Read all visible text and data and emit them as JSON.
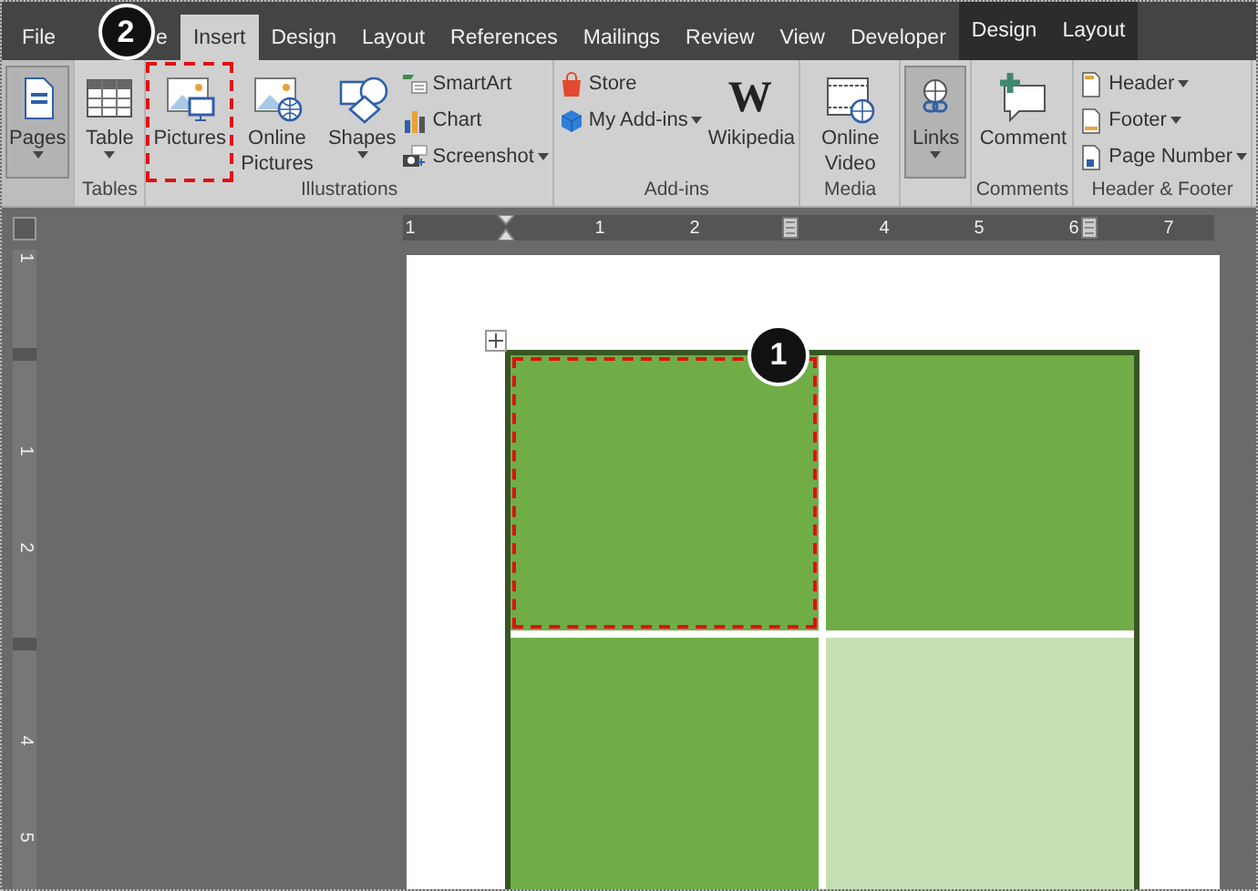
{
  "tabs": [
    {
      "label": "File",
      "selected": false,
      "contextual": false
    },
    {
      "label": "e",
      "selected": false,
      "contextual": false
    },
    {
      "label": "Insert",
      "selected": true,
      "contextual": false
    },
    {
      "label": "Design",
      "selected": false,
      "contextual": false
    },
    {
      "label": "Layout",
      "selected": false,
      "contextual": false
    },
    {
      "label": "References",
      "selected": false,
      "contextual": false
    },
    {
      "label": "Mailings",
      "selected": false,
      "contextual": false
    },
    {
      "label": "Review",
      "selected": false,
      "contextual": false
    },
    {
      "label": "View",
      "selected": false,
      "contextual": false
    },
    {
      "label": "Developer",
      "selected": false,
      "contextual": false
    },
    {
      "label": "Design",
      "selected": false,
      "contextual": true
    },
    {
      "label": "Layout",
      "selected": false,
      "contextual": true
    }
  ],
  "ribbon": {
    "groups": [
      {
        "items": [
          {
            "kind": "large",
            "label": "Pages",
            "dropdown": true,
            "pressed": true,
            "highlighted": false
          }
        ]
      },
      {
        "label": "Tables",
        "items": [
          {
            "kind": "large",
            "label": "Table",
            "dropdown": true,
            "pressed": false,
            "highlighted": false
          }
        ]
      },
      {
        "label": "Illustrations",
        "items": [
          {
            "kind": "large",
            "label": "Pictures",
            "dropdown": false,
            "pressed": false,
            "highlighted": true
          },
          {
            "kind": "large",
            "label": "Online Pictures",
            "dropdown": false,
            "pressed": false,
            "highlighted": false
          },
          {
            "kind": "large",
            "label": "Shapes",
            "dropdown": true,
            "pressed": false,
            "highlighted": false
          },
          {
            "kind": "stack",
            "items": [
              {
                "label": "SmartArt",
                "dropdown": false
              },
              {
                "label": "Chart",
                "dropdown": false
              },
              {
                "label": "Screenshot",
                "dropdown": true
              }
            ]
          }
        ]
      },
      {
        "label": "Add-ins",
        "items": [
          {
            "kind": "stack",
            "items": [
              {
                "label": "Store",
                "dropdown": false
              },
              {
                "label": "My Add-ins",
                "dropdown": true
              }
            ]
          },
          {
            "kind": "large",
            "label": "Wikipedia",
            "glyph": "W",
            "dropdown": false,
            "pressed": false,
            "highlighted": false
          }
        ]
      },
      {
        "label": "Media",
        "items": [
          {
            "kind": "large",
            "label": "Online Video",
            "dropdown": false,
            "pressed": false,
            "highlighted": false
          }
        ]
      },
      {
        "items": [
          {
            "kind": "large",
            "label": "Links",
            "dropdown": true,
            "pressed": true,
            "highlighted": false
          }
        ]
      },
      {
        "label": "Comments",
        "items": [
          {
            "kind": "large",
            "label": "Comment",
            "dropdown": false,
            "pressed": false,
            "highlighted": false
          }
        ]
      },
      {
        "label": "Header & Footer",
        "items": [
          {
            "kind": "stack",
            "items": [
              {
                "label": "Header",
                "dropdown": true
              },
              {
                "label": "Footer",
                "dropdown": true
              },
              {
                "label": "Page Number",
                "dropdown": true
              }
            ]
          }
        ]
      }
    ]
  },
  "ruler": {
    "horizontal": [
      {
        "kind": "number",
        "label": "1"
      },
      {
        "kind": "indent"
      },
      {
        "kind": "number",
        "label": "1"
      },
      {
        "kind": "number",
        "label": "2"
      },
      {
        "kind": "column"
      },
      {
        "kind": "number",
        "label": "4"
      },
      {
        "kind": "number",
        "label": "5"
      },
      {
        "kind": "number",
        "label": "6"
      },
      {
        "kind": "column-end"
      },
      {
        "kind": "number",
        "label": "7"
      }
    ],
    "vertical": [
      {
        "kind": "number",
        "label": "1"
      },
      {
        "kind": "margin"
      },
      {
        "kind": "number",
        "label": "1"
      },
      {
        "kind": "number",
        "label": "2"
      },
      {
        "kind": "row"
      },
      {
        "kind": "number",
        "label": "4"
      },
      {
        "kind": "number",
        "label": "5"
      }
    ]
  },
  "table": {
    "rows": [
      [
        {
          "color": "#70ad47",
          "highlighted": true
        },
        {
          "color": "#70ad47",
          "highlighted": false
        }
      ],
      [
        {
          "color": "#70ad47",
          "highlighted": false
        },
        {
          "color": "#c5e0b4",
          "highlighted": false
        }
      ]
    ]
  },
  "callouts": [
    {
      "label": "2"
    },
    {
      "label": "1"
    }
  ]
}
